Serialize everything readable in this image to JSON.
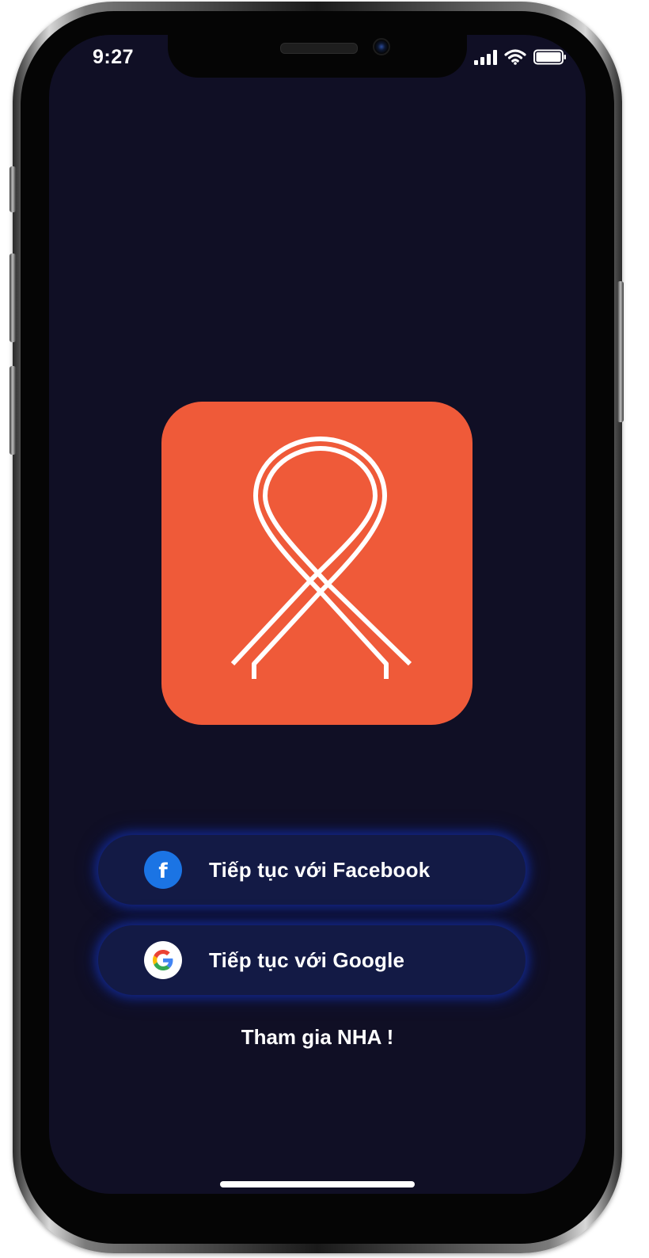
{
  "status_bar": {
    "time": "9:27",
    "icons": [
      "cellular-signal-icon",
      "wifi-icon",
      "battery-icon"
    ]
  },
  "app": {
    "logo_icon": "awareness-ribbon-icon",
    "logo_color": "#ef5a39",
    "background_color": "#100f25"
  },
  "login": {
    "facebook_label": "Tiếp tục với Facebook",
    "facebook_icon": "facebook-icon",
    "facebook_color": "#1b74e4",
    "google_label": "Tiếp tục với Google",
    "google_icon": "google-icon",
    "button_color": "#131a45",
    "button_glow_color": "#142da0"
  },
  "footer": {
    "join_label": "Tham gia NHA !"
  }
}
